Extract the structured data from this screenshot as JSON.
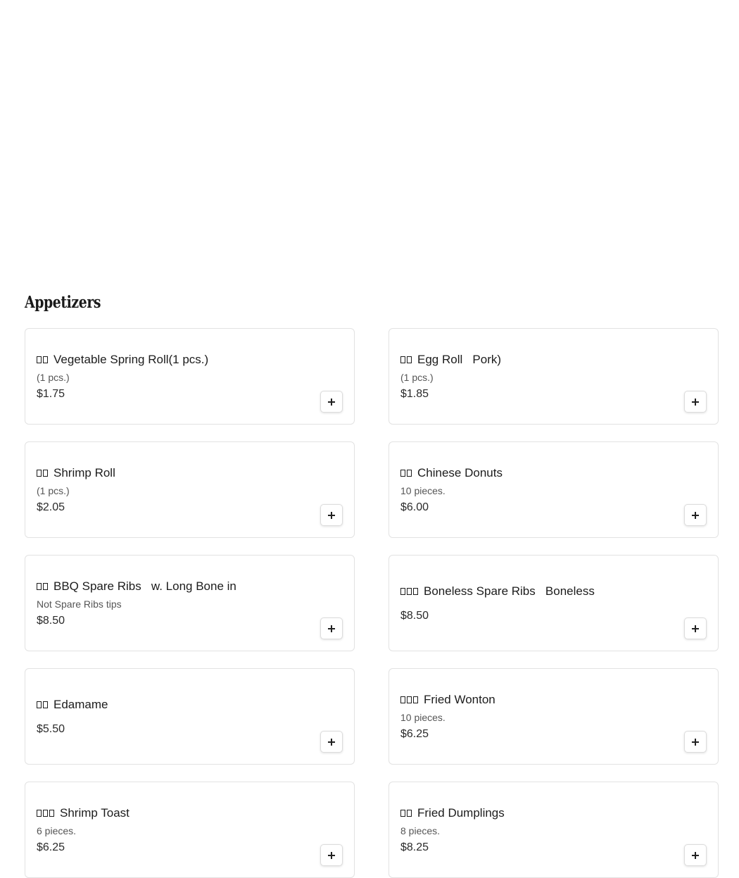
{
  "section": {
    "title": "Appetizers"
  },
  "items": [
    {
      "glyph_count": 2,
      "name": "Vegetable Spring Roll(1 pcs.)",
      "desc": "(1 pcs.)",
      "price": "$1.75"
    },
    {
      "glyph_count": 2,
      "name": "Egg Roll   Pork)",
      "desc": "(1 pcs.)",
      "price": "$1.85"
    },
    {
      "glyph_count": 2,
      "name": "Shrimp Roll",
      "desc": "(1 pcs.)",
      "price": "$2.05"
    },
    {
      "glyph_count": 2,
      "name": "Chinese Donuts",
      "desc": "10 pieces.",
      "price": "$6.00"
    },
    {
      "glyph_count": 2,
      "name": "BBQ Spare Ribs   w. Long Bone in",
      "desc": "Not Spare Ribs tips",
      "price": "$8.50"
    },
    {
      "glyph_count": 3,
      "name": "Boneless Spare Ribs   Boneless",
      "desc": "",
      "price": "$8.50"
    },
    {
      "glyph_count": 2,
      "name": "Edamame",
      "desc": "",
      "price": "$5.50"
    },
    {
      "glyph_count": 3,
      "name": "Fried Wonton",
      "desc": "10 pieces.",
      "price": "$6.25"
    },
    {
      "glyph_count": 3,
      "name": "Shrimp Toast",
      "desc": "6 pieces.",
      "price": "$6.25"
    },
    {
      "glyph_count": 2,
      "name": "Fried Dumplings",
      "desc": "8 pieces.",
      "price": "$8.25"
    }
  ]
}
